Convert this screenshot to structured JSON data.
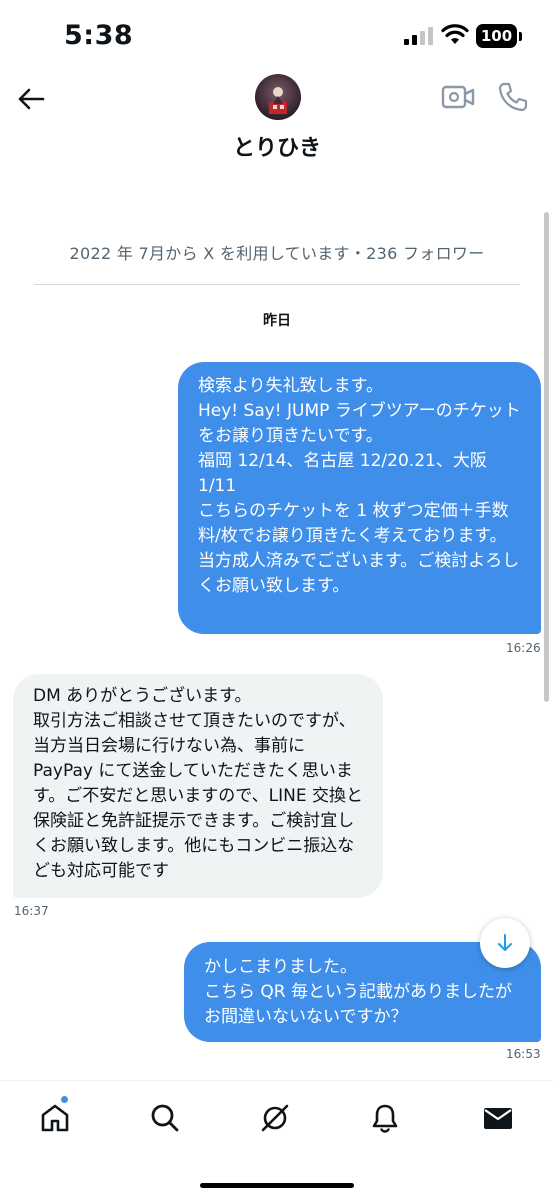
{
  "status_bar": {
    "time": "5:38",
    "battery": "100"
  },
  "header": {
    "contact_name": "とりひき"
  },
  "profile": {
    "meta": "2022 年 7月から X を利用しています・236 フォロワー"
  },
  "conversation": {
    "date_label": "昨日",
    "messages": [
      {
        "direction": "outgoing",
        "text": "検索より失礼致します。\nHey! Say! JUMP ライブツアーのチケットをお譲り頂きたいです。\n福岡 12/14、名古屋 12/20.21、大阪 1/11\nこちらのチケットを 1 枚ずつ定価＋手数料/枚でお譲り頂きたく考えております。\n当方成人済みでございます。ご検討よろしくお願い致します。",
        "time": "16:26"
      },
      {
        "direction": "incoming",
        "text": "DM ありがとうございます。\n取引方法ご相談させて頂きたいのですが、当方当日会場に行けない為、事前に PayPay にて送金していただきたく思います。ご不安だと思いますので、LINE 交換と保険証と免許証提示できます。ご検討宜しくお願い致します。他にもコンビニ振込なども対応可能です",
        "time": "16:37"
      },
      {
        "direction": "outgoing",
        "text": "かしこまりました。\nこちら QR 毎という記載がありましたがお間違いないないですか？",
        "time": "16:53"
      }
    ]
  },
  "colors": {
    "outgoing_bubble": "#3f8ee9",
    "incoming_bubble": "#eff3f4",
    "secondary_text": "#536471"
  },
  "icons": {
    "back": "arrow-left-icon",
    "video": "video-camera-icon",
    "call": "phone-icon",
    "scroll_down": "arrow-down-icon",
    "nav": [
      "home-icon",
      "search-icon",
      "grok-icon",
      "bell-icon",
      "envelope-icon"
    ]
  }
}
